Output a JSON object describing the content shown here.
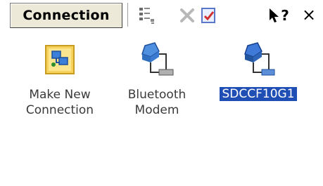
{
  "toolbar": {
    "menu_label": "Connection",
    "icons": [
      "view-details-icon",
      "delete-icon",
      "properties-icon",
      "help-icon",
      "close-icon"
    ],
    "help_mark": "?",
    "close_mark": "×"
  },
  "connections": [
    {
      "label_line1": "Make New",
      "label_line2": "Connection",
      "icon": "make-new-connection-icon",
      "selected": false
    },
    {
      "label_line1": "Bluetooth",
      "label_line2": "Modem",
      "icon": "bluetooth-modem-icon",
      "selected": false
    },
    {
      "label_line1": "SDCCF10G1",
      "label_line2": "",
      "icon": "network-adapter-icon",
      "selected": true
    }
  ],
  "colors": {
    "selection": "#1f4fb4",
    "toolbar_button": "#ece9d8",
    "label_text": "#3a3a3a"
  }
}
